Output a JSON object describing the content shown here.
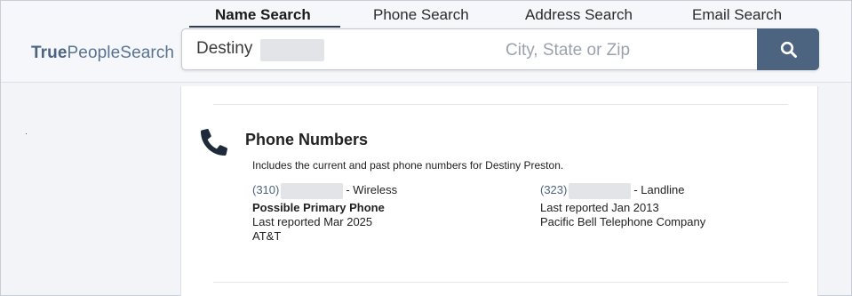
{
  "logo": {
    "bold": "True",
    "rest": "PeopleSearch"
  },
  "tabs": [
    {
      "label": "Name Search",
      "active": true
    },
    {
      "label": "Phone Search",
      "active": false
    },
    {
      "label": "Address Search",
      "active": false
    },
    {
      "label": "Email Search",
      "active": false
    }
  ],
  "search": {
    "name_value": "Destiny",
    "location_placeholder": "City, State or Zip",
    "button_icon": "search-icon"
  },
  "phone_section": {
    "icon": "phone-icon",
    "title": "Phone Numbers",
    "description": "Includes the current and past phone numbers for Destiny Preston.",
    "entries": [
      {
        "area_code": "(310)",
        "type": "- Wireless",
        "primary_label": "Possible Primary Phone",
        "last_reported": "Last reported Mar 2025",
        "carrier": "AT&T"
      },
      {
        "area_code": "(323)",
        "type": "- Landline",
        "last_reported": "Last reported Jan 2013",
        "carrier": "Pacific Bell Telephone Company"
      }
    ]
  },
  "colors": {
    "accent": "#4d6481",
    "background": "#f2f4f7",
    "card": "#ffffff"
  }
}
